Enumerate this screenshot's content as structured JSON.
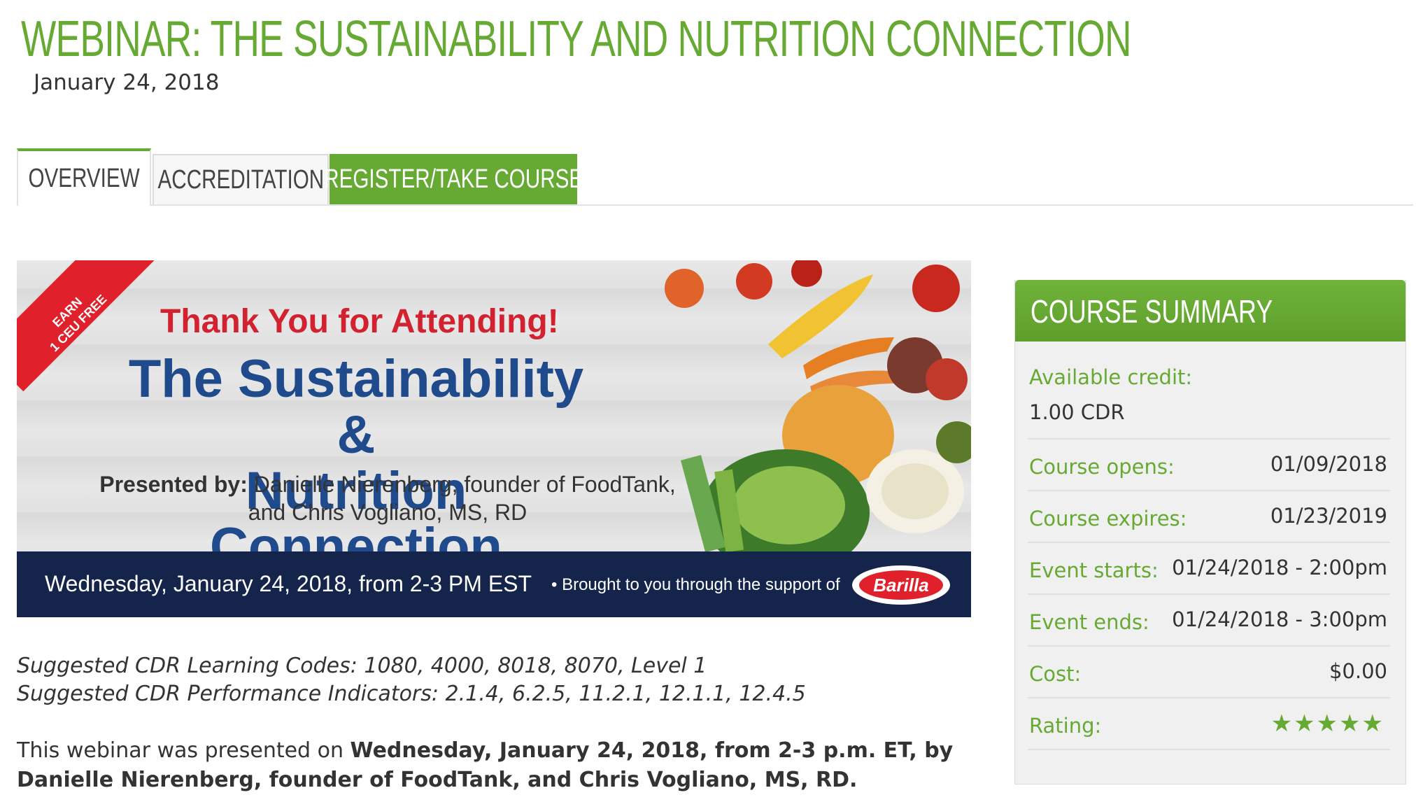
{
  "page_title": "WEBINAR: THE SUSTAINABILITY AND NUTRITION CONNECTION",
  "date": "January 24, 2018",
  "tabs": [
    {
      "label": "OVERVIEW"
    },
    {
      "label": "ACCREDITATION"
    },
    {
      "label": "REGISTER/TAKE COURSE"
    }
  ],
  "banner": {
    "ribbon_line1": "EARN",
    "ribbon_line2": "1 CEU FREE",
    "thanks": "Thank You for Attending!",
    "headline_line1": "The Sustainability &",
    "headline_line2": "Nutrition Connection",
    "presented_label": "Presented by:",
    "presented_line1": "Danielle Nierenberg, founder of FoodTank,",
    "presented_line2": "and Chris Vogliano, MS, RD",
    "event_line": "Wednesday, January 24, 2018, from 2-3 PM EST",
    "bullet": "•",
    "support_text": "Brought to you through the support of",
    "sponsor": "Barilla"
  },
  "codes": {
    "learning": "Suggested CDR Learning Codes: 1080, 4000, 8018, 8070, Level 1",
    "performance": "Suggested CDR Performance Indicators: 2.1.4, 6.2.5, 11.2.1, 12.1.1, 12.4.5"
  },
  "description": {
    "prefix": "This webinar was presented on ",
    "bold": "Wednesday, January 24, 2018, from 2-3 p.m. ET, by Danielle Nierenberg, founder of FoodTank, and Chris Vogliano, MS, RD."
  },
  "summary": {
    "heading": "COURSE SUMMARY",
    "available_credit_label": "Available credit:",
    "available_credit_value": "1.00 CDR",
    "course_opens_label": "Course opens:",
    "course_opens_value": "01/09/2018",
    "course_expires_label": "Course expires:",
    "course_expires_value": "01/23/2019",
    "event_starts_label": "Event starts:",
    "event_starts_value": "01/24/2018 - 2:00pm",
    "event_ends_label": "Event ends:",
    "event_ends_value": "01/24/2018 - 3:00pm",
    "cost_label": "Cost:",
    "cost_value": "$0.00",
    "rating_label": "Rating:",
    "rating_value": 5,
    "rating_icon": "star-icon",
    "accent_color": "#66aa33"
  }
}
